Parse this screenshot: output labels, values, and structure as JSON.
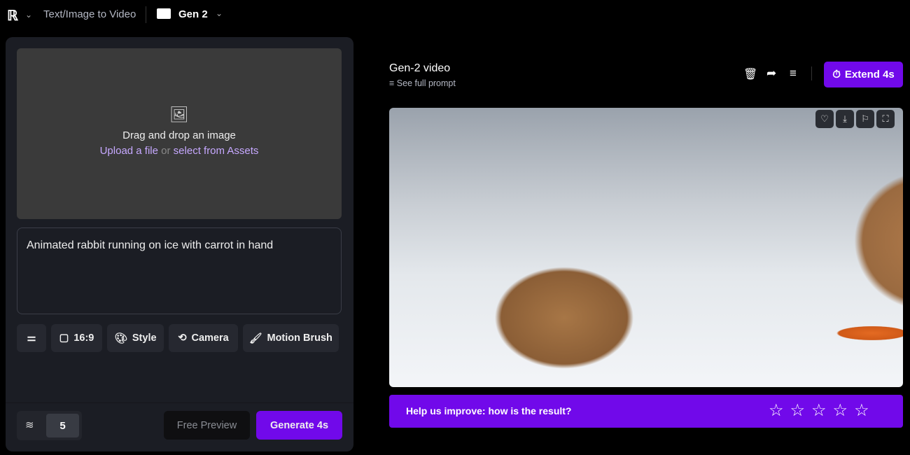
{
  "topbar": {
    "mode": "Text/Image to Video",
    "project": "Gen 2"
  },
  "upload": {
    "title": "Drag and drop an image",
    "upload_link": "Upload a file",
    "or": "or",
    "assets_link": "select from Assets"
  },
  "prompt": {
    "value": "Animated rabbit running on ice with carrot in hand"
  },
  "toolbar": {
    "aspect": "16:9",
    "style": "Style",
    "camera": "Camera",
    "motion_brush": "Motion Brush"
  },
  "footer": {
    "motion_value": "5",
    "free_preview": "Free Preview",
    "generate": "Generate 4s"
  },
  "video": {
    "title": "Gen-2 video",
    "see_prompt": "See full prompt",
    "extend": "Extend 4s"
  },
  "feedback": {
    "question": "Help us improve: how is the result?",
    "rating": 0,
    "max_rating": 5
  },
  "colors": {
    "accent": "#7109ea",
    "panel": "#1b1d24"
  }
}
